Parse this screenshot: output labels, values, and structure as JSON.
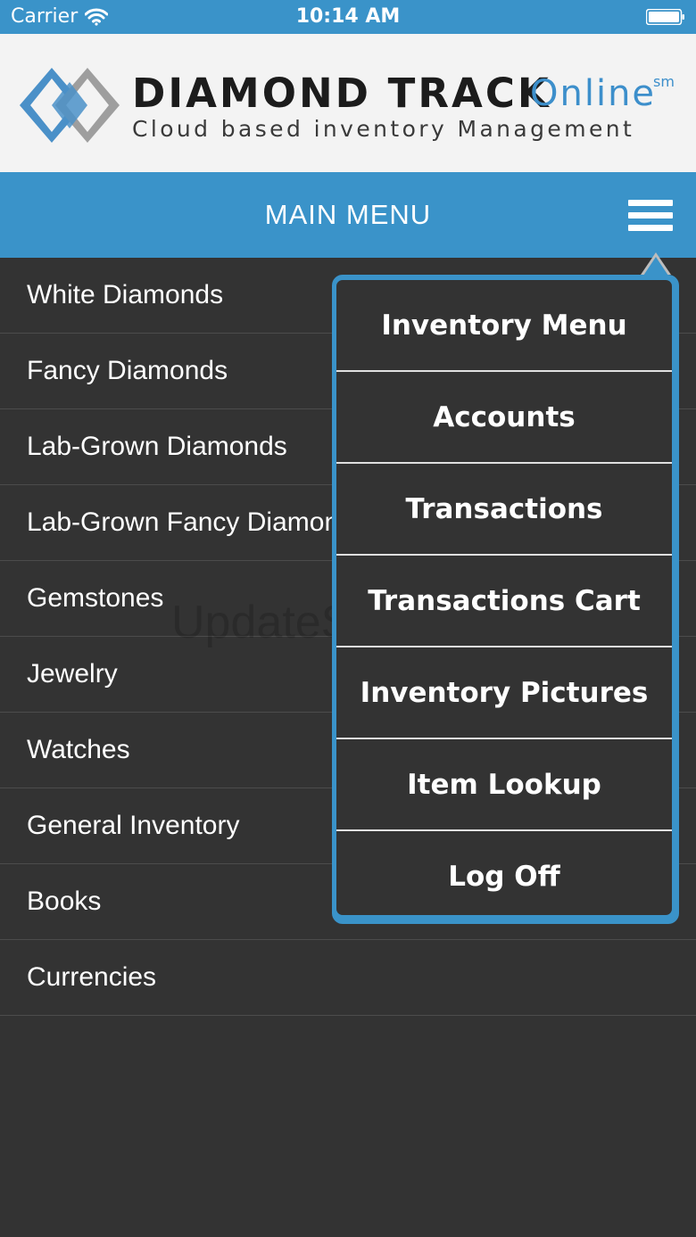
{
  "status_bar": {
    "carrier": "Carrier",
    "time": "10:14 AM"
  },
  "logo": {
    "title": "DIAMOND TRACK",
    "online": "Online",
    "sm": "sm",
    "subtitle": "Cloud based inventory Management"
  },
  "header": {
    "title": "MAIN MENU"
  },
  "main_menu": {
    "items": [
      {
        "label": "White Diamonds"
      },
      {
        "label": "Fancy Diamonds"
      },
      {
        "label": "Lab-Grown Diamonds"
      },
      {
        "label": "Lab-Grown Fancy Diamonds"
      },
      {
        "label": "Gemstones"
      },
      {
        "label": "Jewelry"
      },
      {
        "label": "Watches"
      },
      {
        "label": "General Inventory"
      },
      {
        "label": "Books"
      },
      {
        "label": "Currencies"
      }
    ]
  },
  "dropdown_menu": {
    "items": [
      {
        "label": "Inventory Menu"
      },
      {
        "label": "Accounts"
      },
      {
        "label": "Transactions"
      },
      {
        "label": "Transactions Cart"
      },
      {
        "label": "Inventory Pictures"
      },
      {
        "label": "Item Lookup"
      },
      {
        "label": "Log Off"
      }
    ]
  },
  "watermark": "UpdateStar.com",
  "icons": {
    "wifi": "wifi-icon",
    "battery": "battery-icon",
    "menu": "hamburger-icon",
    "logo": "diamond-logo-icon"
  },
  "colors": {
    "accent": "#3a93c9",
    "background": "#333333",
    "logo_blue": "#3d8fcb"
  }
}
